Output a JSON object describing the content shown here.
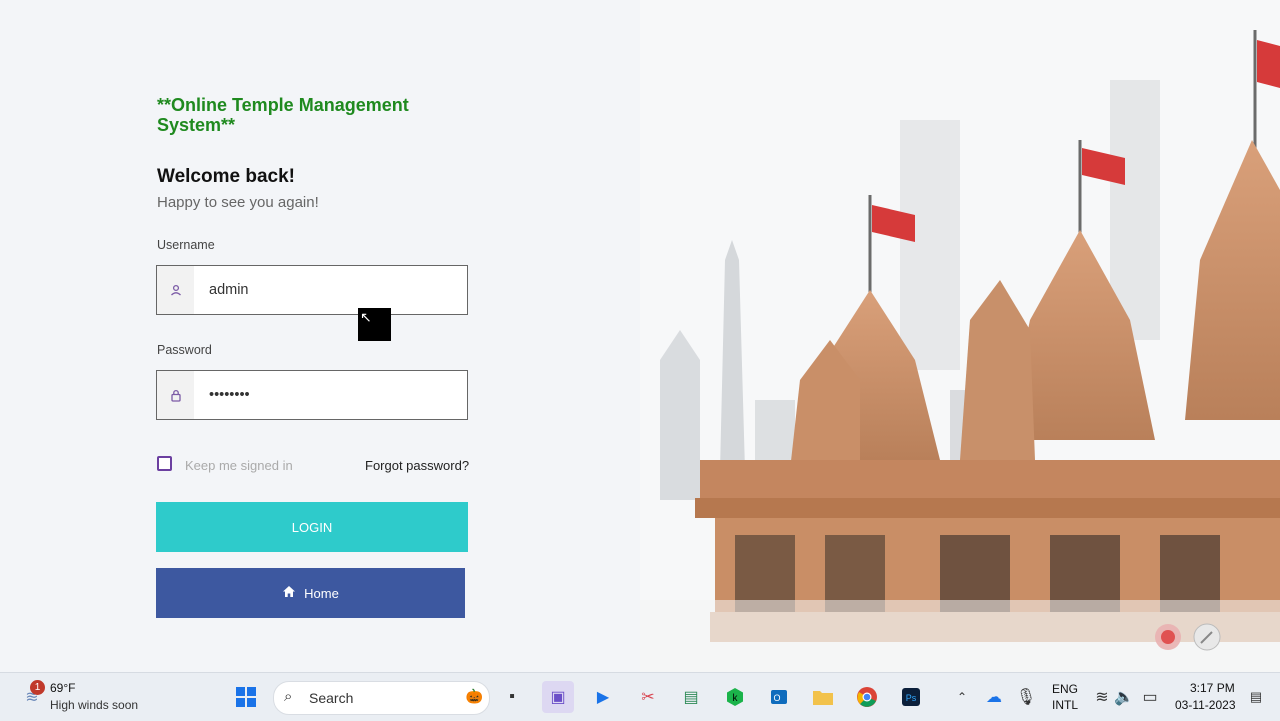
{
  "app": {
    "brand_title": "**Online Temple Management System**",
    "welcome": "Welcome back!",
    "subtitle": "Happy to see you again!",
    "username_label": "Username",
    "username_value": "admin",
    "password_label": "Password",
    "password_value": "••••••••",
    "keep_signed_in": "Keep me signed in",
    "forgot_password": "Forgot password?",
    "login_button": "LOGIN",
    "home_button": "Home",
    "colors": {
      "brand_green": "#1f8a1f",
      "login_teal": "#2ecbcb",
      "home_blue": "#3d58a0"
    }
  },
  "taskbar": {
    "weather_badge": "1",
    "weather_temp": "69°F",
    "weather_condition": "High winds soon",
    "search_label": "Search",
    "language_line1": "ENG",
    "language_line2": "INTL",
    "time": "3:17 PM",
    "date": "03-11-2023",
    "icons": [
      "start-icon",
      "search-icon",
      "file-explorer-icon",
      "meet-icon",
      "video-player-icon",
      "snipping-tool-icon",
      "spreadsheet-icon",
      "kaspersky-icon",
      "outlook-icon",
      "folder-icon",
      "chrome-icon",
      "photoshop-icon"
    ]
  }
}
